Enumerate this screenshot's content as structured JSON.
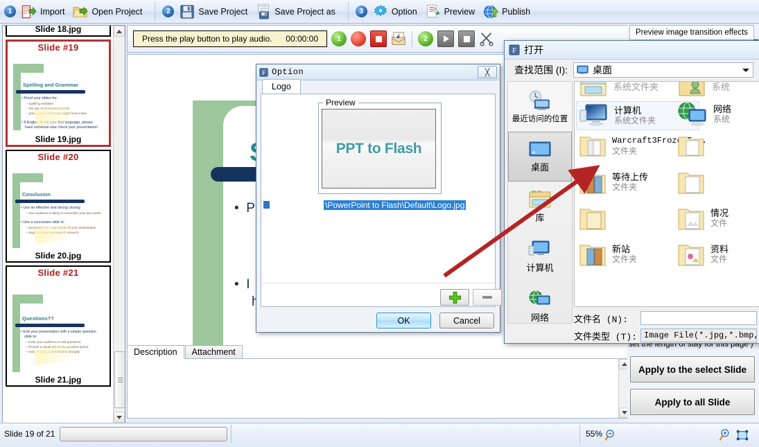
{
  "toolbar": {
    "groups": [
      {
        "step": "1",
        "items": [
          {
            "label": "Import",
            "icon": "import-icon"
          },
          {
            "label": "Open Project",
            "icon": "open-project-icon"
          }
        ]
      },
      {
        "step": "2",
        "items": [
          {
            "label": "Save Project",
            "icon": "save-icon"
          },
          {
            "label": "Save Project as",
            "icon": "save-as-icon"
          }
        ]
      },
      {
        "step": "3",
        "items": [
          {
            "label": "Option",
            "icon": "option-icon"
          },
          {
            "label": "Preview",
            "icon": "preview-icon"
          },
          {
            "label": "Publish",
            "icon": "publish-icon"
          }
        ]
      }
    ]
  },
  "slides": [
    {
      "number": "",
      "filename": "Slide 18.jpg",
      "selected": false,
      "title": "",
      "bullets": []
    },
    {
      "number": "Slide #19",
      "filename": "Slide 19.jpg",
      "selected": true,
      "title": "Spelling and Grammar",
      "bullets": [
        {
          "main": "Proof your slides for:",
          "subs": [
            "spelling mistakes",
            "the use of of repeated words",
            "grammatical errors you might have make"
          ]
        },
        {
          "main": "If English is not your first language, please have someone else check your presentation!",
          "subs": []
        }
      ]
    },
    {
      "number": "Slide #20",
      "filename": "Slide 20.jpg",
      "selected": false,
      "title": "Conclusion",
      "bullets": [
        {
          "main": "Use an effective and strong closing",
          "subs": [
            "Your audience is likely to remember your last words"
          ]
        },
        {
          "main": "Use a conclusion slide to:",
          "subs": [
            "Summarize the main points of your presentation",
            "Suggest future avenues of research"
          ]
        }
      ]
    },
    {
      "number": "Slide #21",
      "filename": "Slide 21.jpg",
      "selected": false,
      "title": "Questions??",
      "bullets": [
        {
          "main": "End your presentation with a simple question slide to:",
          "subs": [
            "Invite your audience to ask questions",
            "Provide a visual aid during question period",
            "Avoid ending a presentation abruptly"
          ]
        }
      ]
    }
  ],
  "audio": {
    "status_text": "Press the play button to play audio.",
    "time": "00:00:00",
    "buttons": [
      {
        "name": "record-step-1",
        "badge": "1"
      },
      {
        "name": "record-button",
        "badge": ""
      },
      {
        "name": "stop-record-button",
        "badge": ""
      },
      {
        "name": "import-audio-button",
        "badge": ""
      },
      {
        "name": "play-step-2",
        "badge": "2"
      },
      {
        "name": "play-button",
        "badge": ""
      },
      {
        "name": "stop-play-button",
        "badge": ""
      },
      {
        "name": "cut-audio-button",
        "badge": ""
      }
    ]
  },
  "stage_slide": {
    "title": "Sp",
    "bullets": [
      "P",
      "I",
      "h"
    ]
  },
  "description_panel": {
    "tabs": [
      {
        "label": "Description",
        "active": true
      },
      {
        "label": "Attachment",
        "active": false
      }
    ],
    "value": ""
  },
  "right_panel": {
    "transition_tip": "Preview image transition effects",
    "stay_note": "set the length of stay for this page )",
    "apply_selected": "Apply to the select Slide",
    "apply_all": "Apply to all Slide"
  },
  "option_dialog": {
    "title": "Option",
    "close_label": "╳",
    "tabs": [
      {
        "label": "Logo",
        "active": true
      }
    ],
    "preview_legend": "Preview",
    "preview_logo_text": "PPT to Flash",
    "list_items": [
      {
        "path": "\\PowerPoint to Flash\\Default\\Logo.jpg",
        "selected": true
      }
    ],
    "add_button": "+",
    "remove_button": "—",
    "ok_button": "OK",
    "cancel_button": "Cancel"
  },
  "open_dialog": {
    "title": "打开",
    "look_in_label": "查找范围 (I):",
    "look_in_value": "桌面",
    "places": [
      {
        "label": "最近访问的位置",
        "icon": "recent-places-icon",
        "selected": false
      },
      {
        "label": "桌面",
        "icon": "desktop-icon",
        "selected": true
      },
      {
        "label": "库",
        "icon": "library-icon",
        "selected": false
      },
      {
        "label": "计算机",
        "icon": "computer-icon",
        "selected": false
      },
      {
        "label": "网络",
        "icon": "network-icon",
        "selected": false
      }
    ],
    "files": [
      {
        "name": "",
        "type": "系统文件夹",
        "icon": "library-icon",
        "col": 0,
        "row": 0,
        "selected": false
      },
      {
        "name": "",
        "type": "系统",
        "icon": "user-folder-icon",
        "col": 1,
        "row": 0,
        "selected": false
      },
      {
        "name": "计算机",
        "type": "系统文件夹",
        "icon": "computer-icon",
        "col": 0,
        "row": 1,
        "selected": true
      },
      {
        "name": "网络",
        "type": "系统",
        "icon": "network-icon",
        "col": 1,
        "row": 1,
        "selected": false
      },
      {
        "name": "Warcraft3FrozenT...",
        "type": "文件夹",
        "icon": "folder-icon",
        "col": 0,
        "row": 2,
        "selected": false
      },
      {
        "name": "",
        "type": "",
        "icon": "folder-icon",
        "col": 1,
        "row": 2,
        "selected": false
      },
      {
        "name": "等待上传",
        "type": "文件夹",
        "icon": "folder-icon",
        "col": 0,
        "row": 3,
        "selected": false
      },
      {
        "name": "",
        "type": "",
        "icon": "folder-icon",
        "col": 1,
        "row": 3,
        "selected": false
      },
      {
        "name": "",
        "type": "",
        "icon": "folder-icon",
        "col": 0,
        "row": 4,
        "selected": false
      },
      {
        "name": "情况",
        "type": "文件",
        "icon": "folder-icon",
        "col": 1,
        "row": 4,
        "selected": false
      },
      {
        "name": "新站",
        "type": "文件夹",
        "icon": "folder-icon",
        "col": 0,
        "row": 5,
        "selected": false
      },
      {
        "name": "资料",
        "type": "文件",
        "icon": "folder-icon",
        "col": 1,
        "row": 5,
        "selected": false
      }
    ],
    "file_name_label": "文件名 (N):",
    "file_name_value": "",
    "file_type_label": "文件类型 (T):",
    "file_type_value": "Image File(*.jpg,*.bmp,*.ti"
  },
  "status_bar": {
    "slide_count": "Slide 19 of 21",
    "zoom_level": "55%",
    "zoom_out_icon": "zoom-out-icon",
    "zoom_in_icon": "zoom-in-icon",
    "fit_icon": "fit-to-window-icon"
  },
  "colors": {
    "accent_blue": "#2a7fd4",
    "highlight_red": "#b02020",
    "arrow_red": "#b52424",
    "slide_green": "#9cc79c",
    "slide_teal": "#2a8a8e",
    "slide_navy": "#16335e"
  }
}
